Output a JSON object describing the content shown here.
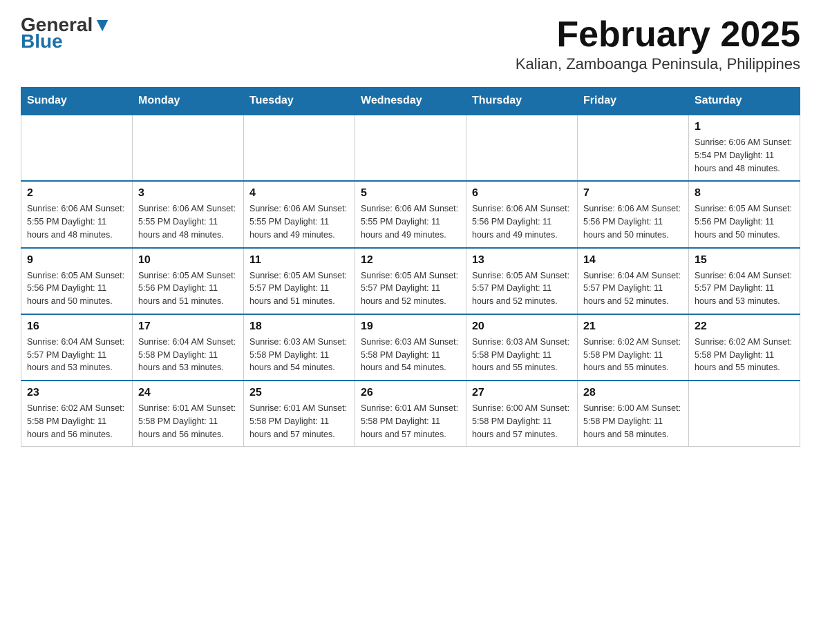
{
  "logo": {
    "general": "General",
    "blue": "Blue"
  },
  "title": "February 2025",
  "location": "Kalian, Zamboanga Peninsula, Philippines",
  "days_of_week": [
    "Sunday",
    "Monday",
    "Tuesday",
    "Wednesday",
    "Thursday",
    "Friday",
    "Saturday"
  ],
  "weeks": [
    [
      {
        "day": "",
        "info": ""
      },
      {
        "day": "",
        "info": ""
      },
      {
        "day": "",
        "info": ""
      },
      {
        "day": "",
        "info": ""
      },
      {
        "day": "",
        "info": ""
      },
      {
        "day": "",
        "info": ""
      },
      {
        "day": "1",
        "info": "Sunrise: 6:06 AM\nSunset: 5:54 PM\nDaylight: 11 hours and 48 minutes."
      }
    ],
    [
      {
        "day": "2",
        "info": "Sunrise: 6:06 AM\nSunset: 5:55 PM\nDaylight: 11 hours and 48 minutes."
      },
      {
        "day": "3",
        "info": "Sunrise: 6:06 AM\nSunset: 5:55 PM\nDaylight: 11 hours and 48 minutes."
      },
      {
        "day": "4",
        "info": "Sunrise: 6:06 AM\nSunset: 5:55 PM\nDaylight: 11 hours and 49 minutes."
      },
      {
        "day": "5",
        "info": "Sunrise: 6:06 AM\nSunset: 5:55 PM\nDaylight: 11 hours and 49 minutes."
      },
      {
        "day": "6",
        "info": "Sunrise: 6:06 AM\nSunset: 5:56 PM\nDaylight: 11 hours and 49 minutes."
      },
      {
        "day": "7",
        "info": "Sunrise: 6:06 AM\nSunset: 5:56 PM\nDaylight: 11 hours and 50 minutes."
      },
      {
        "day": "8",
        "info": "Sunrise: 6:05 AM\nSunset: 5:56 PM\nDaylight: 11 hours and 50 minutes."
      }
    ],
    [
      {
        "day": "9",
        "info": "Sunrise: 6:05 AM\nSunset: 5:56 PM\nDaylight: 11 hours and 50 minutes."
      },
      {
        "day": "10",
        "info": "Sunrise: 6:05 AM\nSunset: 5:56 PM\nDaylight: 11 hours and 51 minutes."
      },
      {
        "day": "11",
        "info": "Sunrise: 6:05 AM\nSunset: 5:57 PM\nDaylight: 11 hours and 51 minutes."
      },
      {
        "day": "12",
        "info": "Sunrise: 6:05 AM\nSunset: 5:57 PM\nDaylight: 11 hours and 52 minutes."
      },
      {
        "day": "13",
        "info": "Sunrise: 6:05 AM\nSunset: 5:57 PM\nDaylight: 11 hours and 52 minutes."
      },
      {
        "day": "14",
        "info": "Sunrise: 6:04 AM\nSunset: 5:57 PM\nDaylight: 11 hours and 52 minutes."
      },
      {
        "day": "15",
        "info": "Sunrise: 6:04 AM\nSunset: 5:57 PM\nDaylight: 11 hours and 53 minutes."
      }
    ],
    [
      {
        "day": "16",
        "info": "Sunrise: 6:04 AM\nSunset: 5:57 PM\nDaylight: 11 hours and 53 minutes."
      },
      {
        "day": "17",
        "info": "Sunrise: 6:04 AM\nSunset: 5:58 PM\nDaylight: 11 hours and 53 minutes."
      },
      {
        "day": "18",
        "info": "Sunrise: 6:03 AM\nSunset: 5:58 PM\nDaylight: 11 hours and 54 minutes."
      },
      {
        "day": "19",
        "info": "Sunrise: 6:03 AM\nSunset: 5:58 PM\nDaylight: 11 hours and 54 minutes."
      },
      {
        "day": "20",
        "info": "Sunrise: 6:03 AM\nSunset: 5:58 PM\nDaylight: 11 hours and 55 minutes."
      },
      {
        "day": "21",
        "info": "Sunrise: 6:02 AM\nSunset: 5:58 PM\nDaylight: 11 hours and 55 minutes."
      },
      {
        "day": "22",
        "info": "Sunrise: 6:02 AM\nSunset: 5:58 PM\nDaylight: 11 hours and 55 minutes."
      }
    ],
    [
      {
        "day": "23",
        "info": "Sunrise: 6:02 AM\nSunset: 5:58 PM\nDaylight: 11 hours and 56 minutes."
      },
      {
        "day": "24",
        "info": "Sunrise: 6:01 AM\nSunset: 5:58 PM\nDaylight: 11 hours and 56 minutes."
      },
      {
        "day": "25",
        "info": "Sunrise: 6:01 AM\nSunset: 5:58 PM\nDaylight: 11 hours and 57 minutes."
      },
      {
        "day": "26",
        "info": "Sunrise: 6:01 AM\nSunset: 5:58 PM\nDaylight: 11 hours and 57 minutes."
      },
      {
        "day": "27",
        "info": "Sunrise: 6:00 AM\nSunset: 5:58 PM\nDaylight: 11 hours and 57 minutes."
      },
      {
        "day": "28",
        "info": "Sunrise: 6:00 AM\nSunset: 5:58 PM\nDaylight: 11 hours and 58 minutes."
      },
      {
        "day": "",
        "info": ""
      }
    ]
  ]
}
